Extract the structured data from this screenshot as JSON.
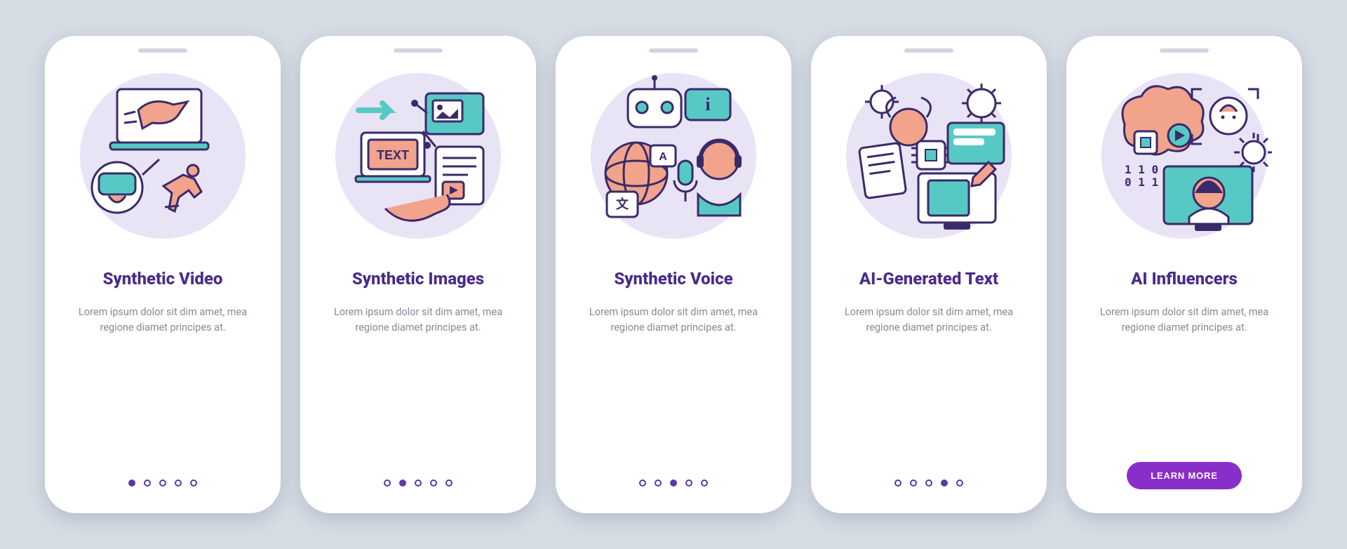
{
  "colors": {
    "purple": "#4a2a8a",
    "accent": "#8a2ec9",
    "teal": "#57c9c4",
    "coral": "#f2a38c",
    "lightPurple": "#e9e3f6",
    "stroke": "#3a2a6a"
  },
  "pagination_total": 5,
  "screens": [
    {
      "id": "synthetic-video",
      "title": "Synthetic Video",
      "body": "Lorem ipsum dolor sit dim amet, mea regione diamet principes at.",
      "active_dot": 0,
      "icon": "video"
    },
    {
      "id": "synthetic-images",
      "title": "Synthetic Images",
      "body": "Lorem ipsum dolor sit dim amet, mea regione diamet principes at.",
      "active_dot": 1,
      "icon": "images"
    },
    {
      "id": "synthetic-voice",
      "title": "Synthetic Voice",
      "body": "Lorem ipsum dolor sit dim amet, mea regione diamet principes at.",
      "active_dot": 2,
      "icon": "voice"
    },
    {
      "id": "ai-generated-text",
      "title": "AI-Generated Text",
      "body": "Lorem ipsum dolor sit dim amet, mea regione diamet principes at.",
      "active_dot": 3,
      "icon": "text"
    },
    {
      "id": "ai-influencers",
      "title": "AI Influencers",
      "body": "Lorem ipsum dolor sit dim amet, mea regione diamet principes at.",
      "active_dot": null,
      "cta": "LEARN MORE",
      "icon": "influencer"
    }
  ]
}
